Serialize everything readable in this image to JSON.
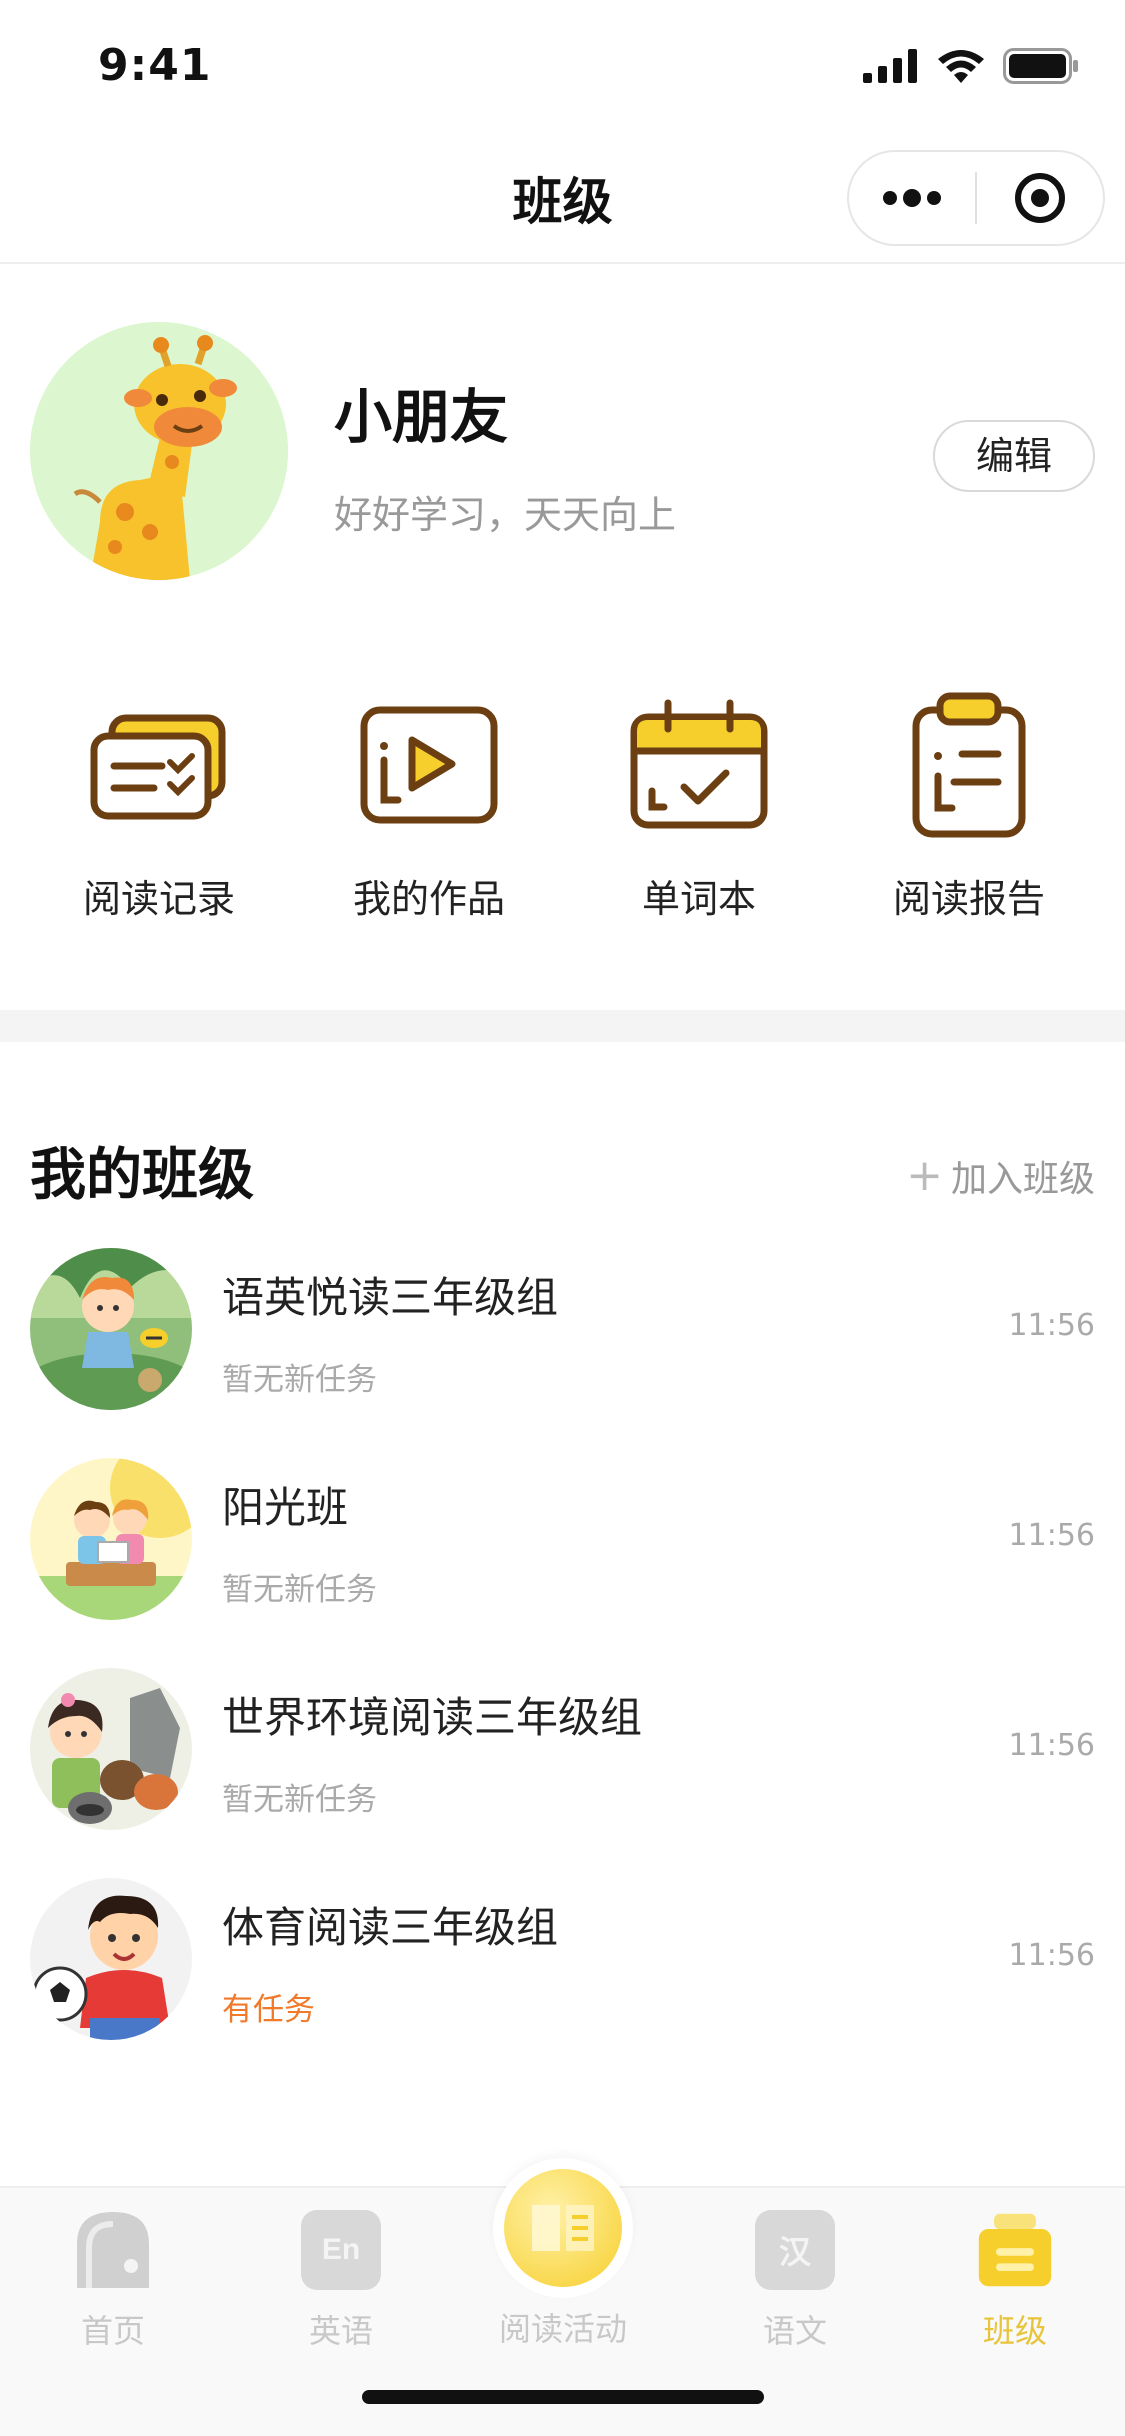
{
  "status_bar": {
    "time": "9:41"
  },
  "nav": {
    "title": "班级"
  },
  "profile": {
    "name": "小朋友",
    "motto": "好好学习，天天向上",
    "edit_label": "编辑"
  },
  "actions": [
    {
      "label": "阅读记录",
      "icon": "reading-record-icon"
    },
    {
      "label": "我的作品",
      "icon": "my-works-icon"
    },
    {
      "label": "单词本",
      "icon": "vocabulary-book-icon"
    },
    {
      "label": "阅读报告",
      "icon": "reading-report-icon"
    }
  ],
  "classes": {
    "title": "我的班级",
    "join_label": "加入班级",
    "items": [
      {
        "name": "语英悦读三年级组",
        "status": "暂无新任务",
        "time": "11:56",
        "has_task": false
      },
      {
        "name": "阳光班",
        "status": "暂无新任务",
        "time": "11:56",
        "has_task": false
      },
      {
        "name": "世界环境阅读三年级组",
        "status": "暂无新任务",
        "time": "11:56",
        "has_task": false
      },
      {
        "name": "体育阅读三年级组",
        "status": "有任务",
        "time": "11:56",
        "has_task": true
      }
    ]
  },
  "tabs": [
    {
      "label": "首页",
      "icon": "home-icon",
      "active": false
    },
    {
      "label": "英语",
      "icon": "english-icon",
      "icon_text": "En",
      "active": false
    },
    {
      "label": "阅读活动",
      "icon": "reading-activity-icon",
      "active": false
    },
    {
      "label": "语文",
      "icon": "chinese-icon",
      "icon_text": "汉",
      "active": false
    },
    {
      "label": "班级",
      "icon": "class-icon",
      "active": true
    }
  ],
  "colors": {
    "accent": "#f7cf2c",
    "brown": "#6b3f12",
    "task": "#f07a2a"
  }
}
